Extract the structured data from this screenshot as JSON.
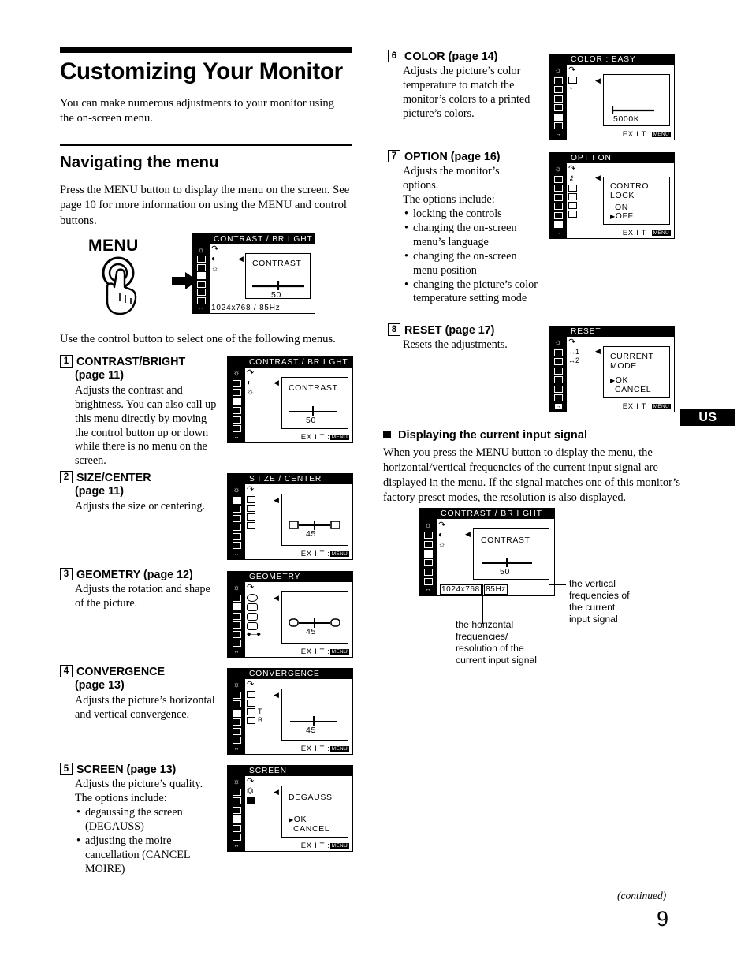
{
  "document": {
    "heading": "Customizing Your Monitor",
    "intro": "You can make numerous adjustments to your monitor using the on-screen menu.",
    "section_heading": "Navigating the menu",
    "section_para": "Press the MENU button to display the menu on the screen. See page 10 for more information on using the MENU and control buttons.",
    "use_control_line": "Use the control button to select one of the following menus.",
    "menu_button_label": "MENU",
    "footer_continued": "(continued)",
    "page_number": "9",
    "region_tab": "US"
  },
  "menu_example": {
    "title": "CONTRAST / BR I GHT",
    "panel_label": "CONTRAST",
    "value": "50",
    "resolution": "1024x768  /  85Hz"
  },
  "items": [
    {
      "num": "1",
      "title": "CONTRAST/BRIGHT",
      "subtitle": "(page 11)",
      "body": "Adjusts the contrast and brightness. You can also call up this menu directly by moving the control button up or down while there is no menu on the screen.",
      "osd": {
        "title": "CONTRAST / BR I GHT",
        "panel_label": "CONTRAST",
        "value": "50",
        "exit": "EX I T :",
        "exit_key": "MENU"
      }
    },
    {
      "num": "2",
      "title": "SIZE/CENTER",
      "subtitle": "(page 11)",
      "body": "Adjusts the size or centering.",
      "osd": {
        "title": "S I ZE / CENTER",
        "panel_label": "",
        "value": "45",
        "exit": "EX I T :",
        "exit_key": "MENU"
      }
    },
    {
      "num": "3",
      "title": "GEOMETRY (page 12)",
      "subtitle": "",
      "body": "Adjusts the rotation and shape of the picture.",
      "osd": {
        "title": "GEOMETRY",
        "panel_label": "",
        "value": "45",
        "exit": "EX I T :",
        "exit_key": "MENU"
      }
    },
    {
      "num": "4",
      "title": "CONVERGENCE",
      "subtitle": "(page 13)",
      "body": "Adjusts the picture’s horizontal and vertical convergence.",
      "osd": {
        "title": "CONVERGENCE",
        "panel_label": "",
        "value": "45",
        "sub_labels": [
          "T",
          "B"
        ],
        "exit": "EX I T :",
        "exit_key": "MENU"
      }
    },
    {
      "num": "5",
      "title": "SCREEN (page 13)",
      "subtitle": "",
      "body": "Adjusts the picture’s quality.",
      "body2": "The options include:",
      "bullets": [
        "degaussing the screen (DEGAUSS)",
        "adjusting the moire cancellation (CANCEL MOIRE)"
      ],
      "osd": {
        "title": "SCREEN",
        "panel_label": "DEGAUSS",
        "options": [
          "OK",
          "CANCEL"
        ],
        "selected": "OK",
        "exit": "EX I T :",
        "exit_key": "MENU"
      }
    },
    {
      "num": "6",
      "title": "COLOR (page 14)",
      "subtitle": "",
      "body": "Adjusts the picture’s color temperature to match the monitor’s colors to a printed picture’s colors.",
      "osd": {
        "title": "COLOR    : EASY",
        "panel_label": "",
        "value": "5000K",
        "exit": "EX I T :",
        "exit_key": "MENU"
      }
    },
    {
      "num": "7",
      "title": "OPTION (page 16)",
      "subtitle": "",
      "body": "Adjusts the monitor’s options.",
      "body2": "The options include:",
      "bullets": [
        "locking the controls",
        "changing the on-screen menu’s language",
        "changing the on-screen menu position",
        "changing the picture’s color temperature setting mode"
      ],
      "osd": {
        "title": "OPT I ON",
        "panel_label": "CONTROL LOCK",
        "options": [
          "ON",
          "OFF"
        ],
        "selected": "OFF",
        "exit": "EX I T :",
        "exit_key": "MENU"
      }
    },
    {
      "num": "8",
      "title": "RESET (page 17)",
      "subtitle": "",
      "body": "Resets the adjustments.",
      "osd": {
        "title": "RESET",
        "panel_label": "CURRENT MODE",
        "options": [
          "OK",
          "CANCEL"
        ],
        "selected": "OK",
        "sub_labels": [
          "1",
          "2"
        ],
        "exit": "EX I T :",
        "exit_key": "MENU"
      }
    }
  ],
  "input_signal": {
    "heading": "Displaying the current input signal",
    "body": "When you press the MENU button to display the menu, the horizontal/vertical frequencies of the current input signal are displayed in the menu. If the signal matches one of this monitor’s factory preset modes, the resolution is also displayed.",
    "osd": {
      "title": "CONTRAST / BR I GHT",
      "panel_label": "CONTRAST",
      "value": "50",
      "resolution_h": "1024x768",
      "separator": "/",
      "resolution_v": "85Hz"
    },
    "callout_vertical": "the vertical frequencies of the current input signal",
    "callout_horizontal": "the horizontal frequencies/ resolution of the current input signal"
  }
}
